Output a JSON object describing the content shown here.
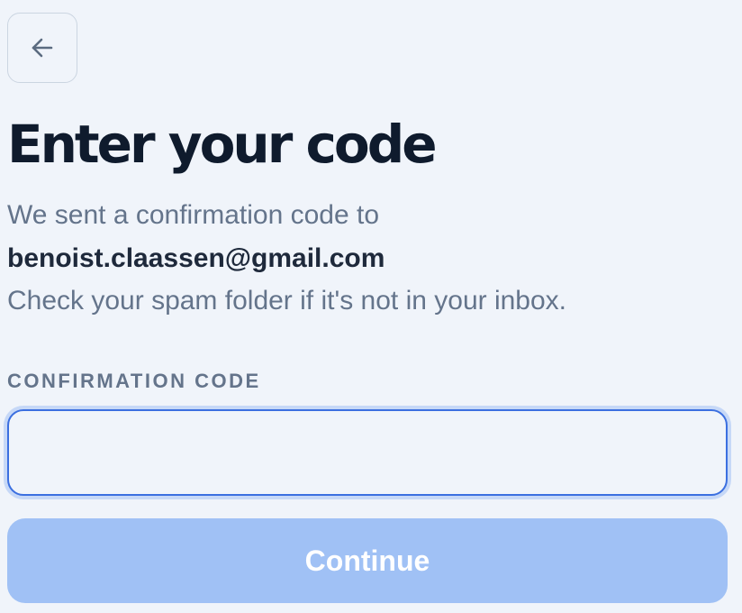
{
  "back_button": {
    "icon": "arrow-left-icon"
  },
  "header": {
    "title": "Enter your code"
  },
  "description": {
    "line_1": "We sent a confirmation code to",
    "email": "benoist.claassen@gmail.com",
    "line_2": "Check your spam folder if it's not in your inbox."
  },
  "form": {
    "code_label": "CONFIRMATION CODE",
    "code_value": "",
    "code_placeholder": "",
    "continue_label": "Continue"
  },
  "colors": {
    "background": "#f0f4fa",
    "title": "#0f1b2d",
    "muted_text": "#64748b",
    "email_text": "#1e293b",
    "input_border_focus": "#3b6fe0",
    "button_disabled_bg": "#a0c1f5",
    "button_text": "#ffffff"
  }
}
